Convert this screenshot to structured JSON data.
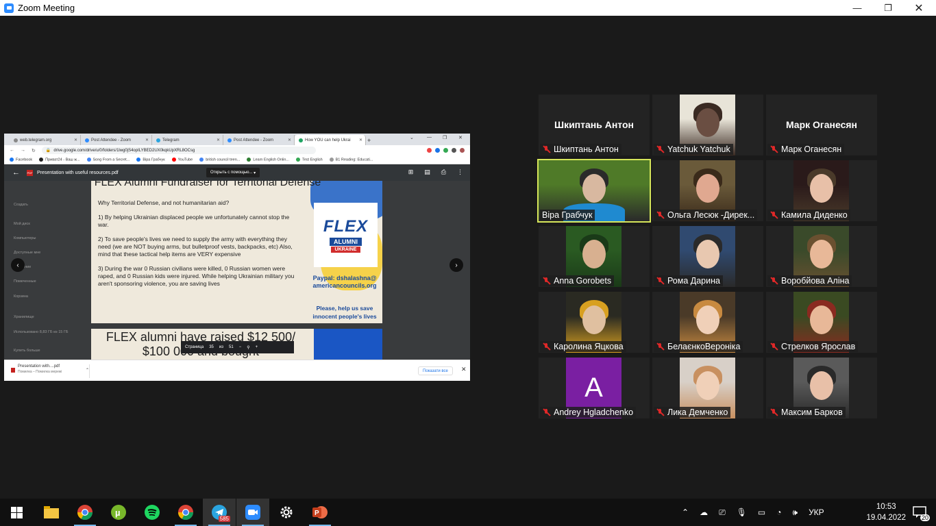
{
  "window": {
    "title": "Zoom Meeting",
    "controls": [
      "minimize",
      "maximize",
      "close"
    ]
  },
  "browser": {
    "tabs": [
      {
        "label": "web.telegram.org",
        "active": false
      },
      {
        "label": "Post Attendee - Zoom",
        "active": false
      },
      {
        "label": "Telegram",
        "active": false
      },
      {
        "label": "Post Attendee - Zoom",
        "active": false
      },
      {
        "label": "How YOU can help Ukrai",
        "active": true
      }
    ],
    "url": "drive.google.com/drive/u/0/folders/1lwg0jS4opILYBED2UX0kqkUpXRL8OCsg",
    "bookmarks": [
      "Facebook",
      "Приват24 - Ваш ж...",
      "Song From a Secret...",
      "Віра Грабчук",
      "YouTube",
      "british council teen...",
      "Learn English Onlin...",
      "Test English",
      "B1 Reading: Educati..."
    ]
  },
  "pdf": {
    "filename": "Presentation with useful resources.pdf",
    "open_with": "Открыть с помощью...",
    "slide_title": "FLEX Alumni Fundraiser for Territorial Defense",
    "paragraphs": [
      "Why Territorial Defense, and not humanitarian aid?",
      "1) By helping Ukrainian displaced people we unfortunately cannot stop the war.",
      "2) To save people's lives we need to supply the army with everything they need (we are NOT buying arms, but bulletproof vests,  backpacks, etc)  Also, mind that these tactical help items are VERY expensive",
      "3) During the war 0 Russian civilians were killed, 0 Russian women were raped, and 0 Russian kids were injured. While helping  Ukrainian military you aren't sponsoring violence, you are saving lives"
    ],
    "logo_flex": "FLEX",
    "logo_alumni": "ALUMNI",
    "logo_ukraine": "UKRAINE",
    "paypal": "Paypal: dshalashna@ americancouncils.org",
    "please": "Please, help us save innocent people's lives",
    "slide2_title": "FLEX alumni have raised $12 500/ $100 000 and bought",
    "pager": {
      "label": "Страница",
      "current": "35",
      "of": "из",
      "total": "51"
    }
  },
  "drive_sidebar": [
    "Создать",
    "Мой диск",
    "Компьютеры",
    "Доступные мне",
    "Недавние",
    "Помеченные",
    "Корзина",
    "Хранилище",
    "Использовано 8,83 ГБ из 15 ГБ",
    "Купить больше"
  ],
  "downloads": {
    "item": "Presentation with....pdf",
    "status": "Помилка – Помилка мережі",
    "show_all": "Показати все"
  },
  "participants": [
    {
      "name": "Шкиптань Антон",
      "video": false,
      "muted": true
    },
    {
      "name": "Yatchuk Yatchuk",
      "video": true,
      "muted": true
    },
    {
      "name": "Марк Оганесян",
      "video": false,
      "muted": true
    },
    {
      "name": "Віра Грабчук",
      "video": true,
      "muted": false,
      "speaking": true
    },
    {
      "name": "Ольга Лесюк -Дирек...",
      "video": true,
      "muted": true
    },
    {
      "name": "Камила Диденко",
      "video": true,
      "muted": true
    },
    {
      "name": "Anna Gorobets",
      "video": true,
      "muted": true
    },
    {
      "name": "Рома Дарина",
      "video": true,
      "muted": true
    },
    {
      "name": "Воробйова Аліна",
      "video": true,
      "muted": true
    },
    {
      "name": "Каролина Яцкова",
      "video": true,
      "muted": true
    },
    {
      "name": "БелаєнкоВероніка",
      "video": true,
      "muted": true
    },
    {
      "name": "Стрелков Ярослав",
      "video": true,
      "muted": true
    },
    {
      "name": "Andrey Hgladchenko",
      "video": false,
      "muted": true,
      "avatar_letter": "A"
    },
    {
      "name": "Лика Демченко",
      "video": true,
      "muted": true
    },
    {
      "name": "Максим Барков",
      "video": true,
      "muted": true
    }
  ],
  "taskbar": {
    "apps": [
      "start",
      "file-explorer",
      "chrome",
      "utorrent",
      "spotify",
      "chrome-profile",
      "telegram",
      "zoom",
      "settings",
      "powerpoint"
    ],
    "telegram_badge": "585",
    "language": "УКР",
    "time": "10:53",
    "date": "19.04.2022",
    "notifications": "20"
  },
  "colors": {
    "speaking_outline": "#d6e65a",
    "muted_red": "#e02828",
    "zoom_blue": "#2d8cff",
    "avatar_purple": "#7a1fa2"
  }
}
